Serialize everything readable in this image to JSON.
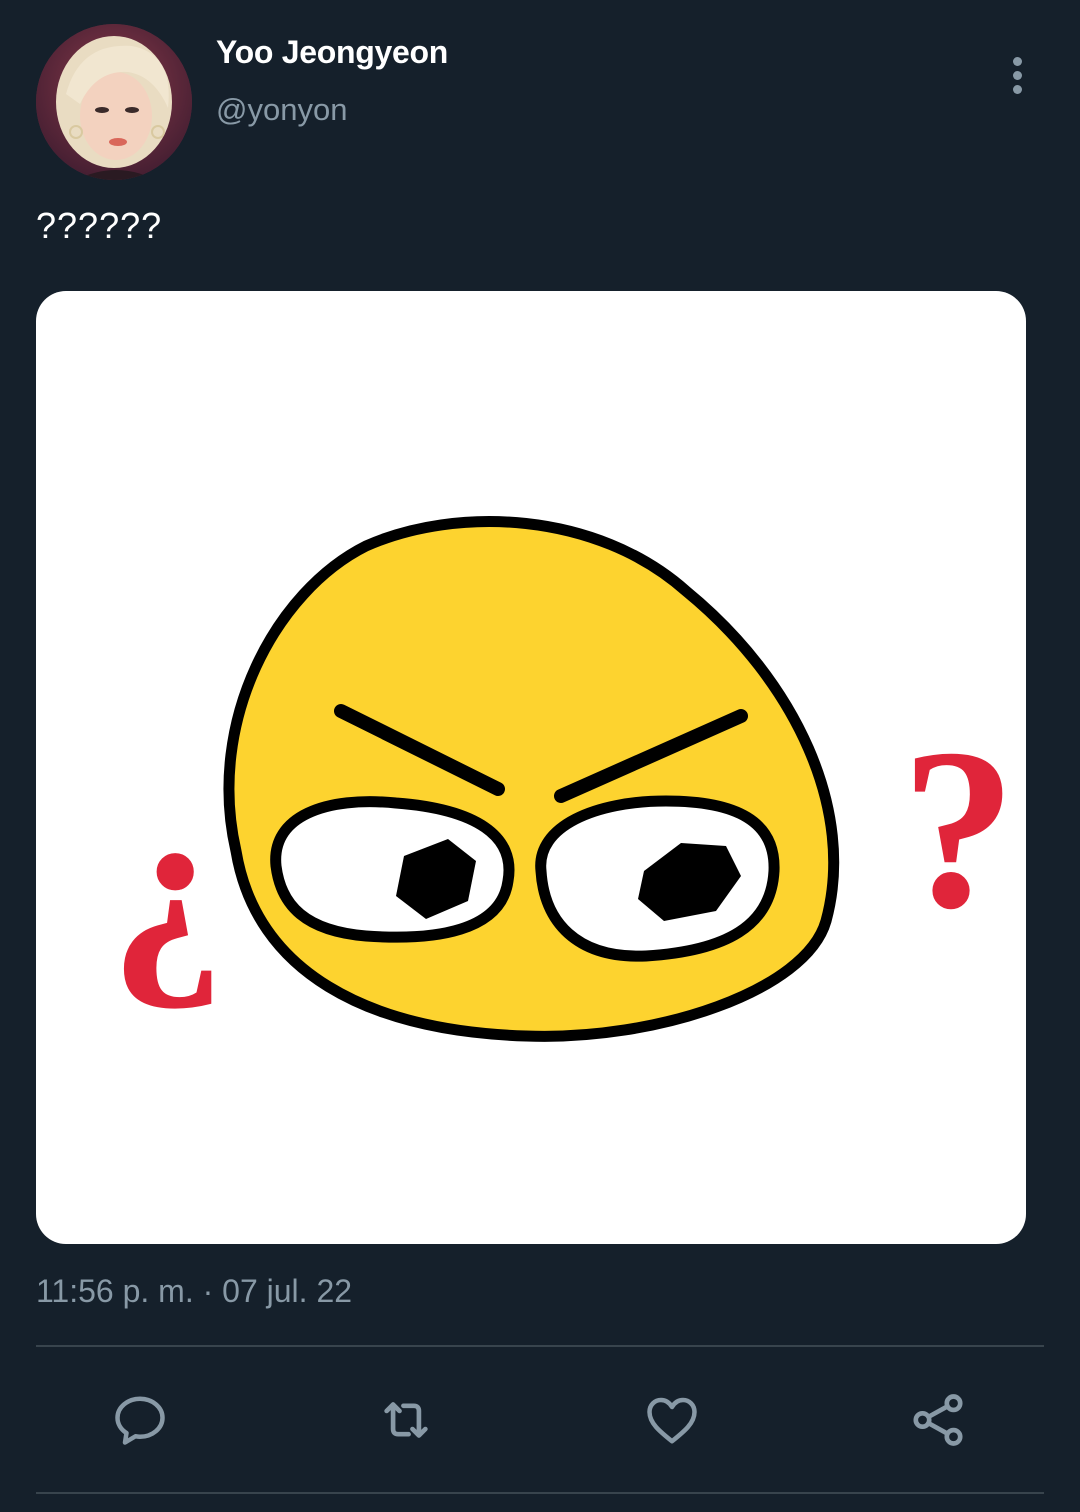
{
  "tweet": {
    "author": {
      "display_name": "Yoo Jeongyeon",
      "handle": "@yonyon"
    },
    "text": "??????",
    "media": {
      "left_mark": "¿",
      "right_mark": "?"
    },
    "timestamp": "11:56 p. m. · 07 jul. 22"
  },
  "actions": [
    {
      "icon": "reply-icon"
    },
    {
      "icon": "retweet-icon"
    },
    {
      "icon": "like-icon"
    },
    {
      "icon": "share-icon"
    }
  ],
  "colors": {
    "background": "#15202b",
    "secondary_text": "#8899a6",
    "divider": "#38444d",
    "emoji_yellow": "#fdd32f",
    "mark_red": "#e0253a"
  }
}
